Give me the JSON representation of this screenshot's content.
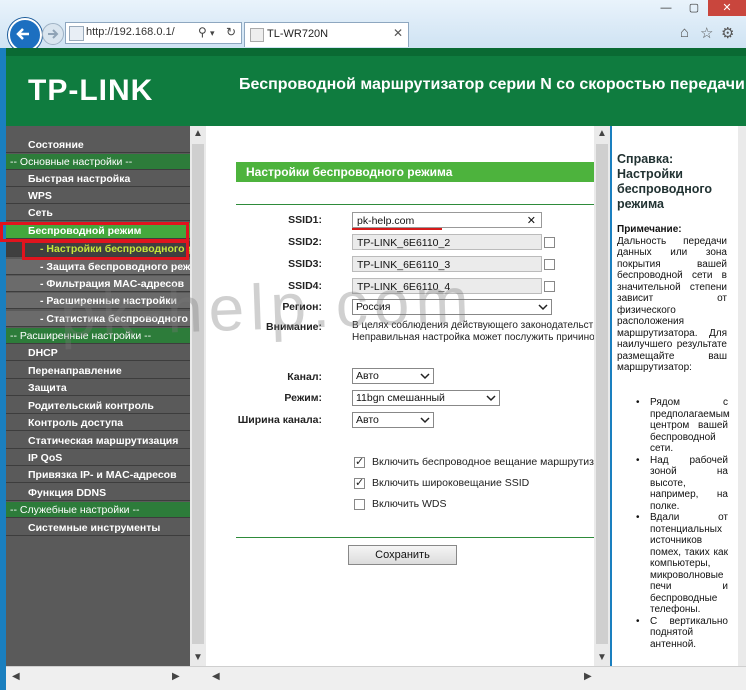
{
  "browser": {
    "address": "http://192.168.0.1/",
    "tab_title": "TL-WR720N"
  },
  "header": {
    "logo": "TP-LINK",
    "title": "Беспроводной маршрутизатор серии N со скоростью передачи д"
  },
  "sidebar": {
    "items": [
      {
        "label": "Состояние",
        "type": "main"
      },
      {
        "label": "-- Основные настройки --",
        "type": "group"
      },
      {
        "label": "Быстрая настройка",
        "type": "main"
      },
      {
        "label": "WPS",
        "type": "main"
      },
      {
        "label": "Сеть",
        "type": "main"
      },
      {
        "label": "Беспроводной режим",
        "type": "active"
      },
      {
        "label": "- Настройки беспроводного режима",
        "type": "subactive"
      },
      {
        "label": "- Защита беспроводного режима",
        "type": "sub"
      },
      {
        "label": "- Фильтрация MAC-адресов",
        "type": "sub"
      },
      {
        "label": "- Расширенные настройки",
        "type": "sub"
      },
      {
        "label": "- Статистика беспроводного режима",
        "type": "sub"
      },
      {
        "label": "-- Расширенные настройки --",
        "type": "group"
      },
      {
        "label": "DHCP",
        "type": "main"
      },
      {
        "label": "Перенаправление",
        "type": "main"
      },
      {
        "label": "Защита",
        "type": "main"
      },
      {
        "label": "Родительский контроль",
        "type": "main"
      },
      {
        "label": "Контроль доступа",
        "type": "main"
      },
      {
        "label": "Статическая маршрутизация",
        "type": "main"
      },
      {
        "label": "IP QoS",
        "type": "main"
      },
      {
        "label": "Привязка IP- и MAC-адресов",
        "type": "main"
      },
      {
        "label": "Функция DDNS",
        "type": "main"
      },
      {
        "label": "-- Служебные настройки --",
        "type": "group"
      },
      {
        "label": "Системные инструменты",
        "type": "main"
      }
    ]
  },
  "main": {
    "title": "Настройки беспроводного режима",
    "ssid1_label": "SSID1:",
    "ssid1_value": "pk-help.com",
    "ssid2_label": "SSID2:",
    "ssid2_value": "TP-LINK_6E6110_2",
    "ssid3_label": "SSID3:",
    "ssid3_value": "TP-LINK_6E6110_3",
    "ssid4_label": "SSID4:",
    "ssid4_value": "TP-LINK_6E6110_4",
    "region_label": "Регион:",
    "region_value": "Россия",
    "warning_label": "Внимание:",
    "warning_line1": "В целях соблюдения действующего законодательст",
    "warning_line2": "Неправильная настройка может послужить причино",
    "channel_label": "Канал:",
    "channel_value": "Авто",
    "mode_label": "Режим:",
    "mode_value": "11bgn смешанный",
    "width_label": "Ширина канала:",
    "width_value": "Авто",
    "opt_broadcast": "Включить беспроводное вещание маршрутизат",
    "opt_ssid_broadcast": "Включить широковещание SSID",
    "opt_wds": "Включить WDS",
    "save_label": "Сохранить"
  },
  "help": {
    "title": "Справка: Настройки беспроводного режима",
    "note_label": "Примечание:",
    "note_text": "Дальность передачи данных или зона покрытия вашей беспроводной сети в значительной степени зависит от физического расположения маршрутизатора. Для наилучшего результате размещайте ваш маршрутизатор:",
    "bullets": [
      "Рядом с предполагаемым центром вашей беспроводной сети.",
      "Над рабочей зоной на высоте, например, на полке.",
      "Вдали от потенциальных источников помех, таких как компьютеры, микроволновые печи и беспроводные телефоны.",
      "С вертикально поднятой антенной."
    ]
  },
  "watermark": "pk-help.com"
}
